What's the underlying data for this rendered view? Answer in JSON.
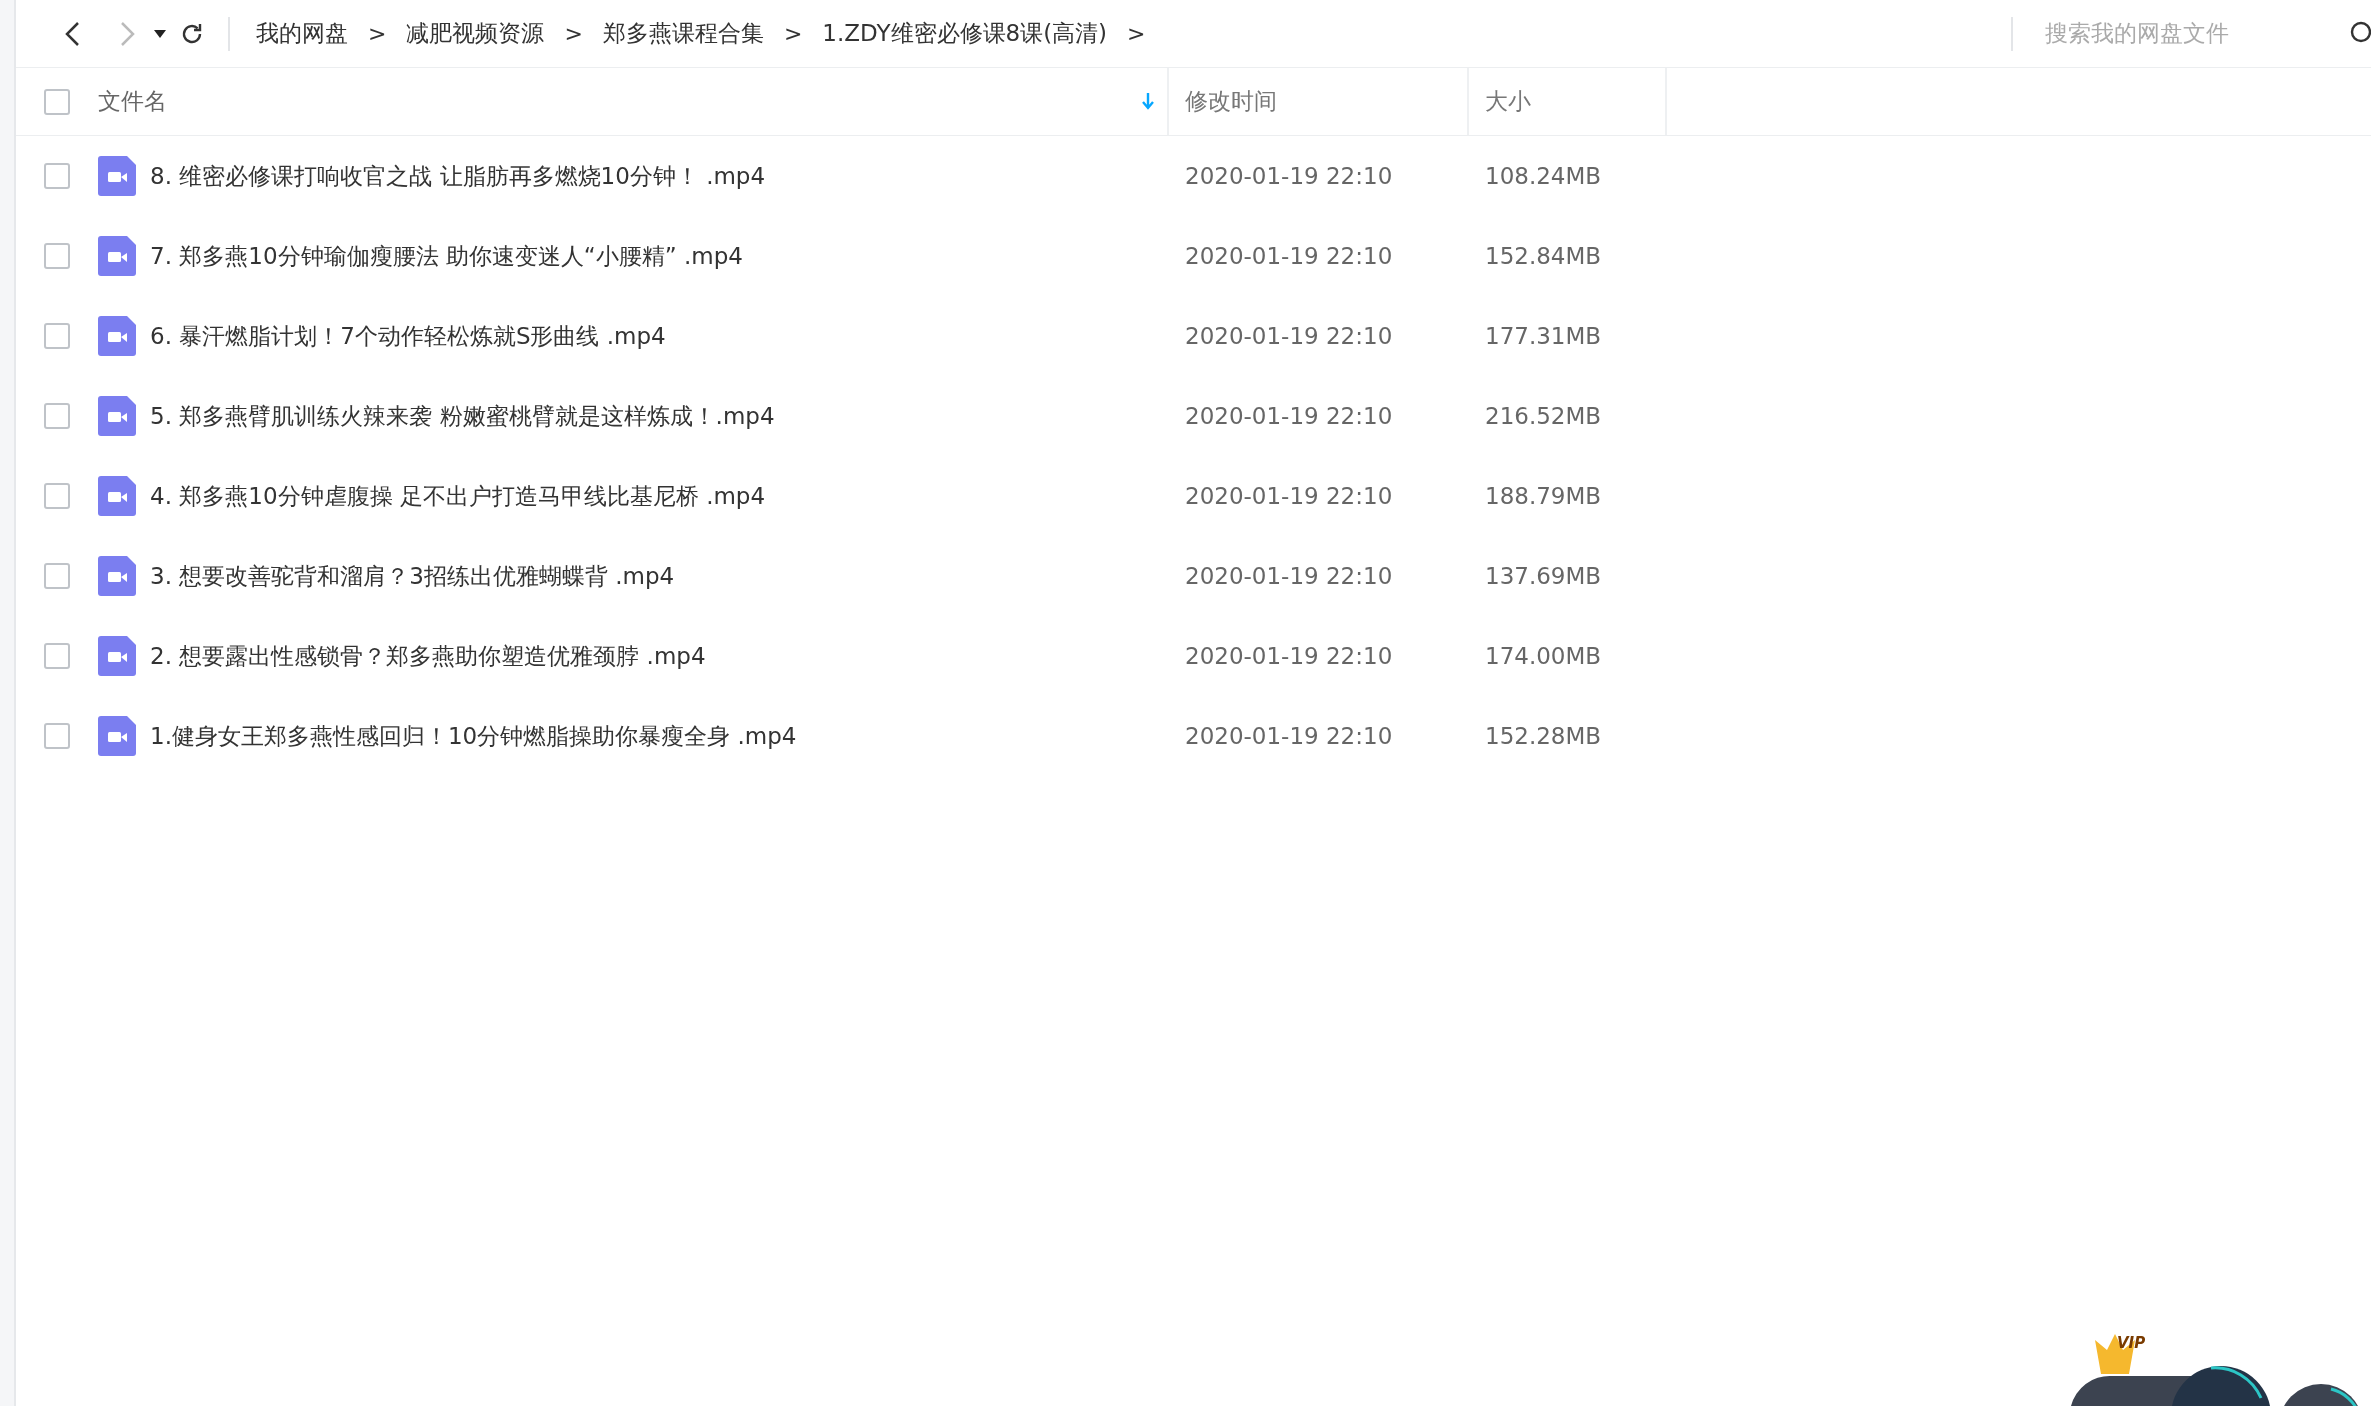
{
  "toolbar": {
    "breadcrumbs": [
      {
        "label": "我的网盘"
      },
      {
        "label": "减肥视频资源"
      },
      {
        "label": "郑多燕课程合集"
      },
      {
        "label": "1.ZDY维密必修课8课(高清)"
      }
    ],
    "separator": ">",
    "search": {
      "placeholder": "搜索我的网盘文件"
    }
  },
  "table": {
    "select_all": {
      "checked": false
    },
    "columns": [
      {
        "label": "文件名",
        "sorted": true
      },
      {
        "label": "修改时间",
        "sorted": false
      },
      {
        "label": "大小",
        "sorted": false
      }
    ],
    "rows": [
      {
        "name": "8. 维密必修课打响收官之战 让脂肪再多燃烧10分钟！ .mp4",
        "modified": "2020-01-19 22:10",
        "size": "108.24MB",
        "checked": false
      },
      {
        "name": "7. 郑多燕10分钟瑜伽瘦腰法 助你速变迷人“小腰精” .mp4",
        "modified": "2020-01-19 22:10",
        "size": "152.84MB",
        "checked": false
      },
      {
        "name": "6. 暴汗燃脂计划！7个动作轻松炼就S形曲线 .mp4",
        "modified": "2020-01-19 22:10",
        "size": "177.31MB",
        "checked": false
      },
      {
        "name": "5. 郑多燕臂肌训练火辣来袭 粉嫩蜜桃臂就是这样炼成！.mp4",
        "modified": "2020-01-19 22:10",
        "size": "216.52MB",
        "checked": false
      },
      {
        "name": "4. 郑多燕10分钟虐腹操 足不出户打造马甲线比基尼桥 .mp4",
        "modified": "2020-01-19 22:10",
        "size": "188.79MB",
        "checked": false
      },
      {
        "name": "3. 想要改善驼背和溜肩？3招练出优雅蝴蝶背 .mp4",
        "modified": "2020-01-19 22:10",
        "size": "137.69MB",
        "checked": false
      },
      {
        "name": "2. 想要露出性感锁骨？郑多燕助你塑造优雅颈脖 .mp4",
        "modified": "2020-01-19 22:10",
        "size": "174.00MB",
        "checked": false
      },
      {
        "name": "1.健身女王郑多燕性感回归！10分钟燃脂操助你暴瘦全身 .mp4",
        "modified": "2020-01-19 22:10",
        "size": "152.28MB",
        "checked": false
      }
    ]
  },
  "vip_widget": {
    "badge": "VIP"
  }
}
